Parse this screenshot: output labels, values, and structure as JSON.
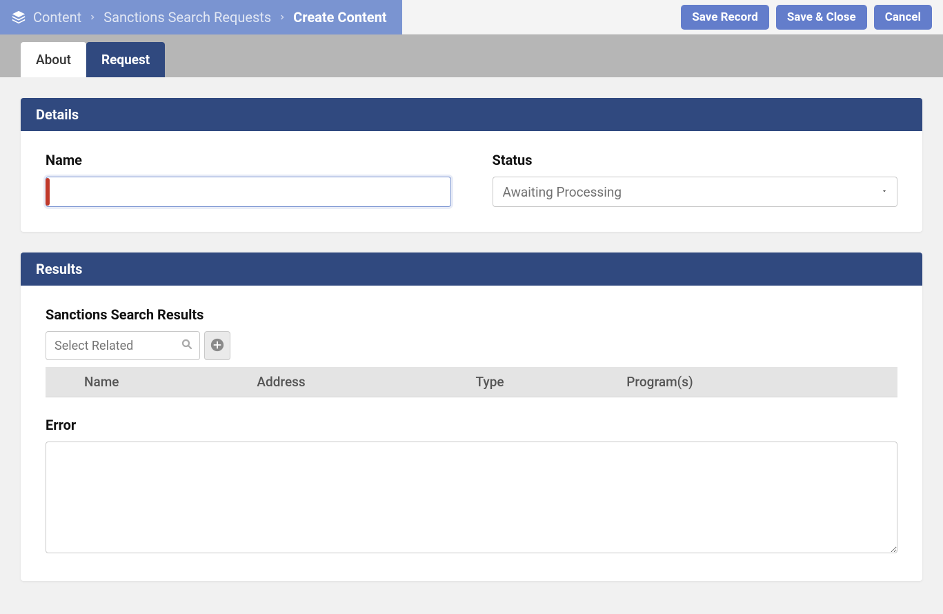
{
  "breadcrumb": {
    "items": [
      "Content",
      "Sanctions Search Requests"
    ],
    "current": "Create Content"
  },
  "actions": {
    "save": "Save Record",
    "save_close": "Save & Close",
    "cancel": "Cancel"
  },
  "tabs": {
    "about": "About",
    "request": "Request"
  },
  "details": {
    "header": "Details",
    "name_label": "Name",
    "name_value": "",
    "status_label": "Status",
    "status_value": "Awaiting Processing"
  },
  "results": {
    "header": "Results",
    "subtitle": "Sanctions Search Results",
    "related_placeholder": "Select Related",
    "columns": {
      "name": "Name",
      "address": "Address",
      "type": "Type",
      "programs": "Program(s)"
    },
    "error_label": "Error",
    "error_value": ""
  }
}
